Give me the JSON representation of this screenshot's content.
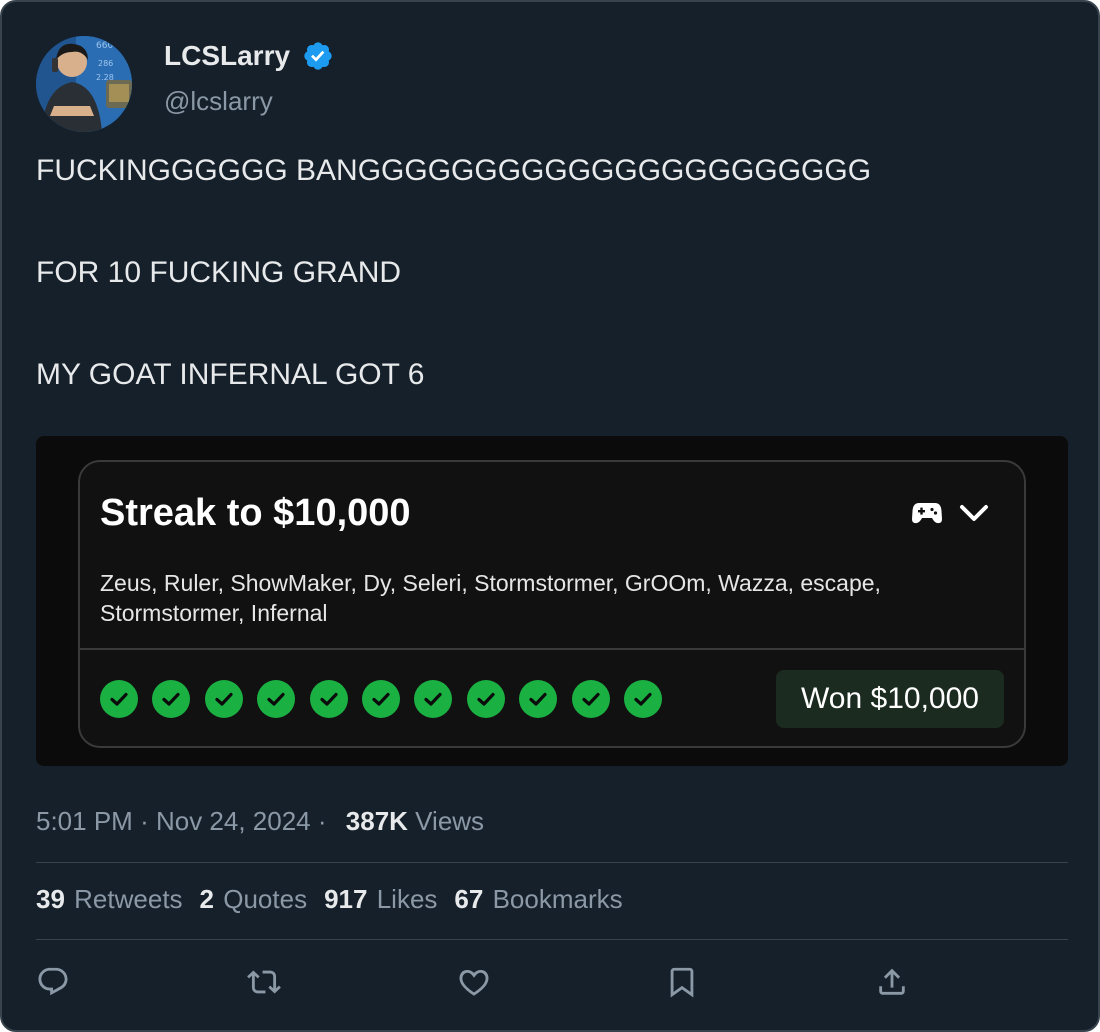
{
  "author": {
    "display_name": "LCSLarry",
    "handle": "@lcslarry",
    "verified": true,
    "verified_icon": "verified-badge-icon"
  },
  "tweet": {
    "lines": [
      "FUCKINGGGGGG BANGGGGGGGGGGGGGGGGGGGGGG",
      "FOR 10 FUCKING GRAND",
      "MY GOAT INFERNAL GOT 6"
    ]
  },
  "media": {
    "title": "Streak to $10,000",
    "players": "Zeus, Ruler, ShowMaker, Dy, Seleri, Stormstormer, GrOOm, Wazza, escape, Stormstormer, Infernal",
    "check_count": 11,
    "result": "Won $10,000",
    "icons": [
      "gamepad-icon",
      "chevron-down-icon",
      "check-circle-icon"
    ],
    "colors": {
      "check": "#1ab042",
      "badge_bg": "#1b2b1f"
    }
  },
  "meta": {
    "time": "5:01 PM",
    "sep1": "·",
    "date": "Nov 24, 2024",
    "sep2": "·",
    "views_count": "387K",
    "views_label": "Views"
  },
  "stats": {
    "retweets": {
      "count": "39",
      "label": "Retweets"
    },
    "quotes": {
      "count": "2",
      "label": "Quotes"
    },
    "likes": {
      "count": "917",
      "label": "Likes"
    },
    "bookmarks": {
      "count": "67",
      "label": "Bookmarks"
    }
  },
  "actions": [
    "reply-icon",
    "retweet-icon",
    "like-icon",
    "bookmark-icon",
    "share-icon"
  ],
  "colors": {
    "background": "#15202b",
    "border": "#38444d",
    "muted": "#8b98a5",
    "verified": "#1d9bf0"
  }
}
